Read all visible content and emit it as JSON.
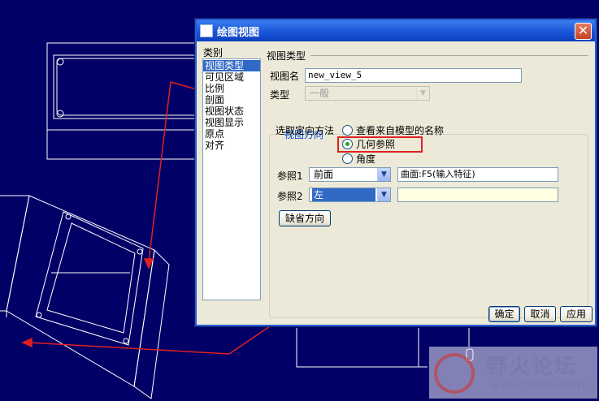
{
  "dialog": {
    "title": "绘图视图",
    "close_label": "✕",
    "category_label": "类别",
    "categories": [
      "视图类型",
      "可见区域",
      "比例",
      "剖面",
      "视图状态",
      "视图显示",
      "原点",
      "对齐"
    ],
    "section_title": "视图类型",
    "view_name_label": "视图名",
    "view_name_value": "new_view_5",
    "type_label": "类型",
    "type_value": "一般",
    "orientation_group_title": "视图方向",
    "method_label": "选取定向方法",
    "options": [
      "查看来自模型的名称",
      "几何参照",
      "角度"
    ],
    "ref1_label": "参照1",
    "ref1_value": "前面",
    "ref1_text": "曲面:F5(输入特征)",
    "ref2_label": "参照2",
    "ref2_value": "左",
    "ref2_text": "",
    "default_orient_label": "缺省方向",
    "ok_label": "确定",
    "cancel_label": "取消",
    "apply_label": "应用"
  },
  "watermark": {
    "title": "野火论坛",
    "url": "www.proewildfire.cn"
  },
  "colors": {
    "background": "#000066",
    "cad_lines": "#ffffff",
    "annotation": "#e02020",
    "selection": "#316ac5"
  }
}
